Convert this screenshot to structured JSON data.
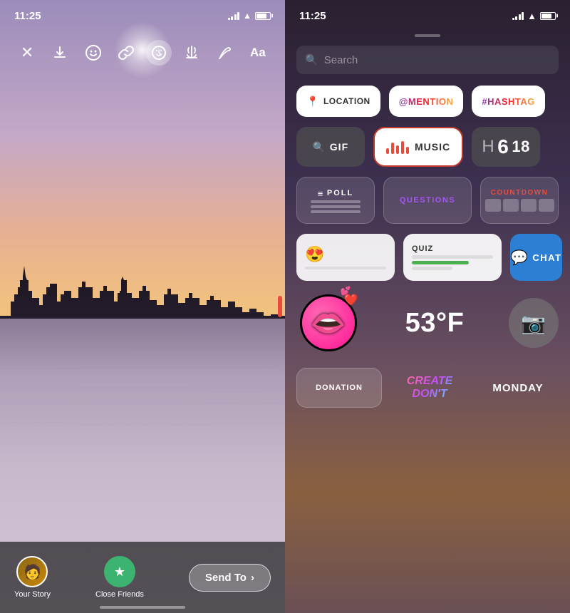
{
  "left": {
    "status": {
      "time": "11:25"
    },
    "toolbar": {
      "close_label": "✕",
      "download_label": "⬇",
      "emoji_label": "☺",
      "link_label": "🔗",
      "sticker_label": "☺",
      "audio_label": "🔊",
      "draw_label": "✏",
      "text_label": "Aa"
    },
    "bottom": {
      "your_story_label": "Your Story",
      "close_friends_label": "Close Friends",
      "send_to_label": "Send To",
      "send_arrow": "›"
    }
  },
  "right": {
    "status": {
      "time": "11:25"
    },
    "search": {
      "placeholder": "Search"
    },
    "stickers": {
      "row1": [
        {
          "id": "location",
          "label": "LOCATION",
          "icon": "📍"
        },
        {
          "id": "mention",
          "label": "@MENTION"
        },
        {
          "id": "hashtag",
          "label": "#HASHTAG"
        }
      ],
      "row2": [
        {
          "id": "gif",
          "label": "GIF",
          "icon": "🔍"
        },
        {
          "id": "music",
          "label": "MUSIC"
        },
        {
          "id": "dice",
          "label": "618"
        }
      ],
      "row3": [
        {
          "id": "poll",
          "label": "POLL"
        },
        {
          "id": "questions",
          "label": "QUESTIONS"
        },
        {
          "id": "countdown",
          "label": "COUNTDOWN"
        }
      ],
      "row4": [
        {
          "id": "emoji-slider",
          "emoji": "😍"
        },
        {
          "id": "quiz",
          "label": "QUIZ"
        },
        {
          "id": "chat",
          "label": "CHAT"
        }
      ],
      "row5": [
        {
          "id": "sticker-mouth",
          "emoji": "👄"
        },
        {
          "id": "temp",
          "label": "53°F"
        },
        {
          "id": "camera"
        }
      ],
      "row6": [
        {
          "id": "donation",
          "label": "DONATION"
        },
        {
          "id": "create",
          "label": "CREATE\nDON'T"
        },
        {
          "id": "monday",
          "label": "MONDAY"
        }
      ]
    }
  }
}
